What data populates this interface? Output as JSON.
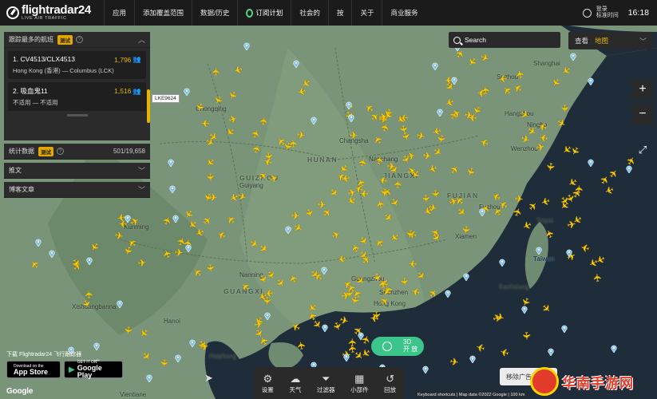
{
  "header": {
    "logo_name": "flightradar24",
    "logo_sub": "LIVE AIR TRAFFIC",
    "nav": [
      "应用",
      "添加覆盖范围",
      "数据/历史",
      "订阅计划",
      "社会的",
      "按",
      "关于",
      "商业服务"
    ],
    "login": "登录",
    "login_sub": "标准时间",
    "time": "16:18"
  },
  "panel": {
    "tracked_title": "跟踪最多的航班",
    "beta": "测试",
    "flights": [
      {
        "rank_id": "1. CV4513/CLX4513",
        "count": "1,796",
        "route": "Hong Kong (香港) — Columbus (LCK)"
      },
      {
        "rank_id": "2. 吸血鬼11",
        "count": "1,516",
        "route": "不适用 — 不适用"
      }
    ],
    "stats_title": "统计数据",
    "stats_value": "501/19,658",
    "news_title": "推文",
    "blog_title": "博客文章"
  },
  "callsign_tag": "LKE9624",
  "search": {
    "label": "Search"
  },
  "view": {
    "label": "查看",
    "value": "地图"
  },
  "zoom": {
    "in": "+",
    "out": "−"
  },
  "download": {
    "label": "下载 Flightradar24 飞行跟踪器",
    "appstore_small": "Download on the",
    "appstore": "App Store",
    "gplay_small": "GET IT ON",
    "gplay": "Google Play"
  },
  "google": "Google",
  "btn3d": {
    "label": "3D",
    "label2": "开 放"
  },
  "toolbar": [
    {
      "icon": "settings-icon",
      "glyph": "⚙",
      "label": "设置"
    },
    {
      "icon": "weather-icon",
      "glyph": "☁",
      "label": "天气"
    },
    {
      "icon": "filter-icon",
      "glyph": "⏷",
      "label": "过滤器"
    },
    {
      "icon": "widgets-icon",
      "glyph": "▦",
      "label": "小部件"
    },
    {
      "icon": "playback-icon",
      "glyph": "↺",
      "label": "回放"
    }
  ],
  "map_footer": "Keyboard shortcuts | Map data ©2022 Google | 100 km",
  "move": "移除广告",
  "watermark": "华南手游网",
  "map_labels": [
    {
      "t": "Shanghai"
    },
    {
      "t": "Suzhou"
    },
    {
      "t": "Hangzhou"
    },
    {
      "t": "Ningbo"
    },
    {
      "t": "Wenzhou"
    },
    {
      "t": "Changsha"
    },
    {
      "t": "Nanchang"
    },
    {
      "t": "HUNAN"
    },
    {
      "t": "JIANGXI"
    },
    {
      "t": "FUJIAN"
    },
    {
      "t": "Fuzhou"
    },
    {
      "t": "Xiamen"
    },
    {
      "t": "Chongqing"
    },
    {
      "t": "Guiyang"
    },
    {
      "t": "GUIZHOU"
    },
    {
      "t": "Kunming"
    },
    {
      "t": "Nanning"
    },
    {
      "t": "GUANGXI"
    },
    {
      "t": "Guangzhou"
    },
    {
      "t": "Shenzhen"
    },
    {
      "t": "Hong Kong"
    },
    {
      "t": "Haiphong"
    },
    {
      "t": "Hanoi"
    },
    {
      "t": "Taipei"
    },
    {
      "t": "Taiwan"
    },
    {
      "t": "Kaohsiung"
    },
    {
      "t": "Xishuangbanna"
    },
    {
      "t": "Vientiane"
    }
  ]
}
